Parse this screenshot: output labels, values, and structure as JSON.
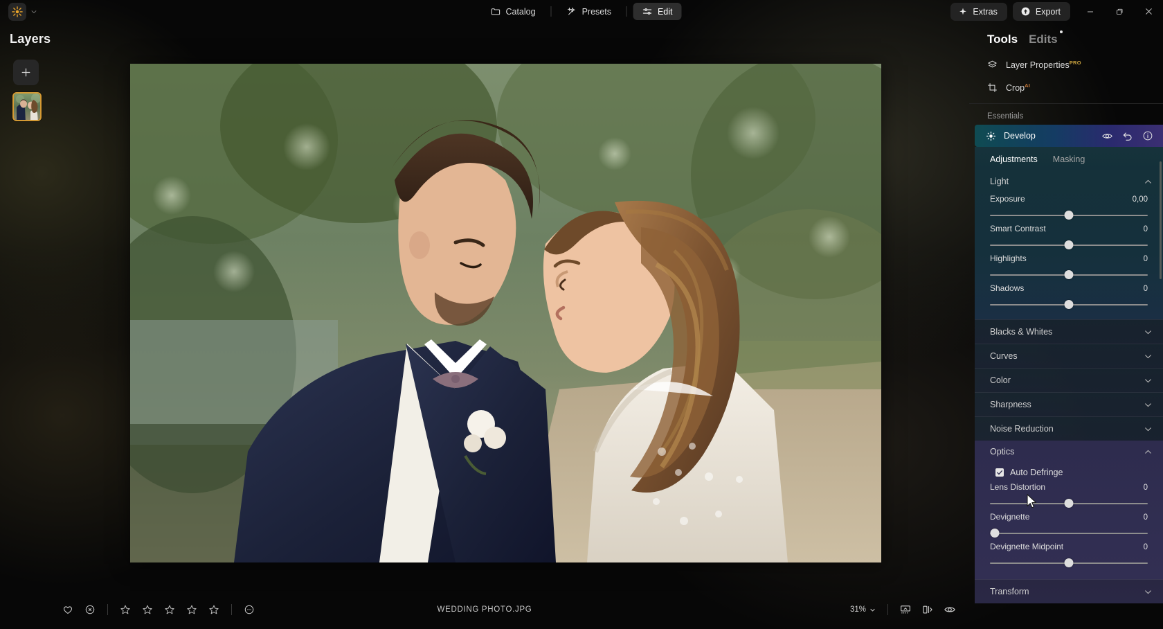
{
  "app": {
    "logo_icon": "sunburst-logo-icon",
    "logo_chevron_icon": "chevron-down-icon"
  },
  "topnav": {
    "items": [
      {
        "label": "Catalog",
        "icon": "folder-icon",
        "active": false
      },
      {
        "label": "Presets",
        "icon": "sparkle-wand-icon",
        "active": false
      },
      {
        "label": "Edit",
        "icon": "sliders-icon",
        "active": true
      }
    ]
  },
  "window": {
    "extras_label": "Extras",
    "extras_icon": "sparkle-icon",
    "export_label": "Export",
    "export_icon": "upload-circle-icon",
    "minimize_icon": "minimize-icon",
    "maximize_icon": "restore-icon",
    "close_icon": "close-icon"
  },
  "layers": {
    "title": "Layers",
    "add_icon": "plus-icon",
    "thumbnail_name": "layer-thumbnail-wedding-photo"
  },
  "canvas": {
    "image_alt": "wedding couple photo"
  },
  "bottombar": {
    "favorite_icon": "heart-icon",
    "reject_icon": "circle-x-icon",
    "stars": 5,
    "star_icon": "star-outline-icon",
    "more_icon": "circle-more-icon",
    "filename": "WEDDING PHOTO.JPG",
    "zoom_value": "31%",
    "zoom_chevron_icon": "chevron-down-icon",
    "filmstrip_icon": "filmstrip-icon",
    "compare_icon": "compare-split-icon",
    "preview_icon": "eye-icon"
  },
  "tools": {
    "tab_tools": "Tools",
    "tab_edits": "Edits",
    "edits_has_badge": true,
    "rows": [
      {
        "label": "Layer Properties",
        "tag": "PRO",
        "icon": "layers-icon"
      },
      {
        "label": "Crop",
        "tag": "AI",
        "icon": "crop-icon"
      }
    ],
    "section_label": "Essentials",
    "develop": {
      "label": "Develop",
      "icon": "sun-icon",
      "visibility_icon": "eye-icon",
      "reset_icon": "undo-icon",
      "info_icon": "info-icon",
      "subtabs": [
        {
          "label": "Adjustments",
          "active": true
        },
        {
          "label": "Masking",
          "active": false
        }
      ],
      "groups": [
        {
          "title": "Light",
          "expanded": true,
          "chevron": "chevron-up-icon",
          "sliders": [
            {
              "label": "Exposure",
              "value": "0,00",
              "pos": 50
            },
            {
              "label": "Smart Contrast",
              "value": "0",
              "pos": 50
            },
            {
              "label": "Highlights",
              "value": "0",
              "pos": 50
            },
            {
              "label": "Shadows",
              "value": "0",
              "pos": 50
            }
          ]
        },
        {
          "title": "Blacks & Whites",
          "expanded": false,
          "chevron": "chevron-down-icon"
        },
        {
          "title": "Curves",
          "expanded": false,
          "chevron": "chevron-down-icon"
        },
        {
          "title": "Color",
          "expanded": false,
          "chevron": "chevron-down-icon"
        },
        {
          "title": "Sharpness",
          "expanded": false,
          "chevron": "chevron-down-icon"
        },
        {
          "title": "Noise Reduction",
          "expanded": false,
          "chevron": "chevron-down-icon"
        },
        {
          "title": "Optics",
          "expanded": true,
          "chevron": "chevron-up-icon",
          "checkbox": {
            "label": "Auto Defringe",
            "checked": true
          },
          "sliders": [
            {
              "label": "Lens Distortion",
              "value": "0",
              "pos": 50
            },
            {
              "label": "Devignette",
              "value": "0",
              "pos": 2
            },
            {
              "label": "Devignette Midpoint",
              "value": "0",
              "pos": 50
            }
          ]
        },
        {
          "title": "Transform",
          "expanded": false,
          "chevron": "chevron-down-icon"
        }
      ]
    }
  },
  "colors": {
    "accent_gold": "#d49a34",
    "pro_tag": "#caa33f",
    "ai_tag": "#c97a3a",
    "develop_gradient_start": "#0f4b52",
    "develop_gradient_end": "#3b2f72",
    "panel_bg": "#141414"
  }
}
